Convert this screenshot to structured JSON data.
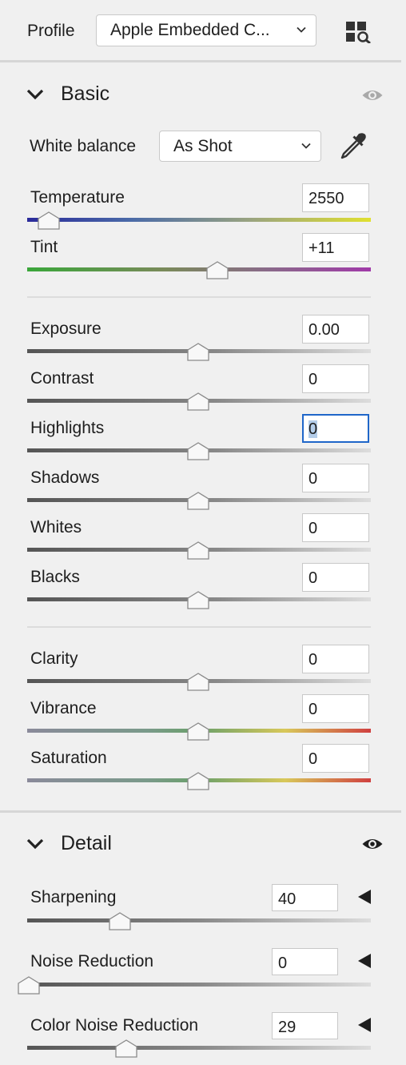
{
  "profile": {
    "label": "Profile",
    "value": "Apple Embedded C...",
    "browse_icon": "profile-browser-icon"
  },
  "basic": {
    "title": "Basic",
    "visibility_icon": "eye-icon",
    "white_balance": {
      "label": "White balance",
      "value": "As Shot",
      "picker_icon": "eyedropper-icon"
    },
    "sliders": [
      {
        "label": "Temperature",
        "value": "2550",
        "position": 0.06
      },
      {
        "label": "Tint",
        "value": "+11",
        "position": 0.55
      },
      {
        "label": "Exposure",
        "value": "0.00",
        "position": 0.5
      },
      {
        "label": "Contrast",
        "value": "0",
        "position": 0.5
      },
      {
        "label": "Highlights",
        "value": "0",
        "position": 0.5
      },
      {
        "label": "Shadows",
        "value": "0",
        "position": 0.5
      },
      {
        "label": "Whites",
        "value": "0",
        "position": 0.5
      },
      {
        "label": "Blacks",
        "value": "0",
        "position": 0.5
      },
      {
        "label": "Clarity",
        "value": "0",
        "position": 0.5
      },
      {
        "label": "Vibrance",
        "value": "0",
        "position": 0.5
      },
      {
        "label": "Saturation",
        "value": "0",
        "position": 0.5
      }
    ]
  },
  "detail": {
    "title": "Detail",
    "visibility_icon": "eye-icon",
    "sliders": [
      {
        "label": "Sharpening",
        "value": "40",
        "position": 0.27
      },
      {
        "label": "Noise Reduction",
        "value": "0",
        "position": 0.0
      },
      {
        "label": "Color Noise Reduction",
        "value": "29",
        "position": 0.29
      }
    ]
  },
  "colors": {
    "focus_border": "#1f66c9",
    "eye_active": "#1e1e1e",
    "eye_inactive": "#a9a9a9"
  }
}
